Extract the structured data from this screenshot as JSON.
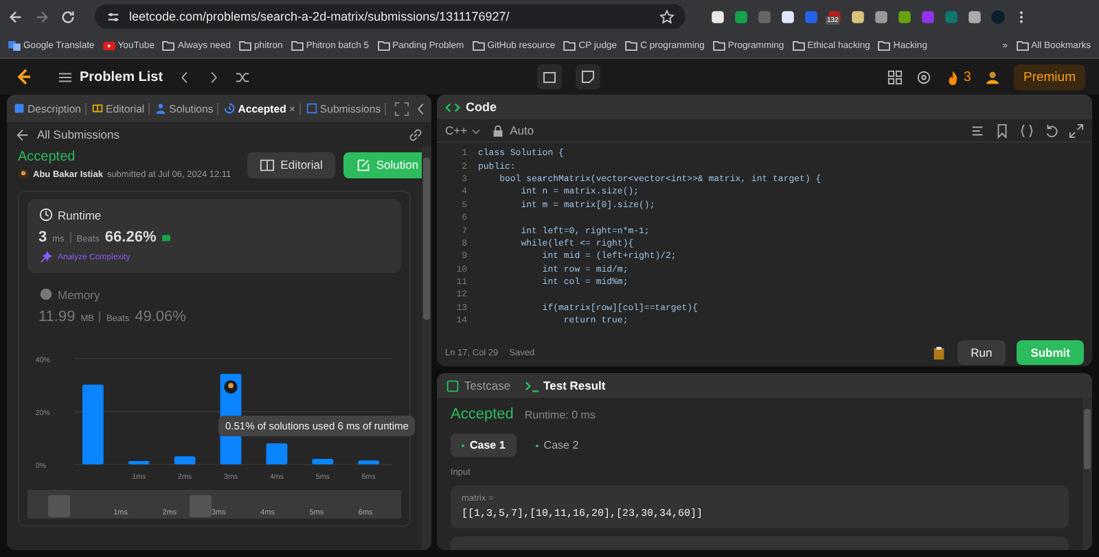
{
  "browser": {
    "url": "leetcode.com/problems/search-a-2d-matrix/submissions/1311176927/",
    "extension_badge": "132",
    "bookmarks": [
      {
        "label": "Google Translate",
        "kind": "translate"
      },
      {
        "label": "YouTube",
        "kind": "video"
      },
      {
        "label": "Always need",
        "kind": "folder"
      },
      {
        "label": "phitron",
        "kind": "folder"
      },
      {
        "label": "Phitron batch 5",
        "kind": "folder"
      },
      {
        "label": "Panding Problem",
        "kind": "folder"
      },
      {
        "label": "GitHub resource",
        "kind": "folder"
      },
      {
        "label": "CP judge",
        "kind": "folder"
      },
      {
        "label": "C programming",
        "kind": "folder"
      },
      {
        "label": "Programming",
        "kind": "folder"
      },
      {
        "label": "Ethical hacking",
        "kind": "folder"
      },
      {
        "label": "Hacking",
        "kind": "folder"
      }
    ],
    "more": "»",
    "all_bookmarks": "All Bookmarks"
  },
  "nav": {
    "problem_list": "Problem List",
    "streak": "3",
    "premium": "Premium"
  },
  "left": {
    "tabs": [
      {
        "label": "Description",
        "kind": "description",
        "selected": false
      },
      {
        "label": "Editorial",
        "kind": "editorial",
        "selected": false
      },
      {
        "label": "Solutions",
        "kind": "solutions",
        "selected": false
      },
      {
        "label": "Accepted",
        "kind": "accepted",
        "selected": true,
        "close": "×"
      },
      {
        "label": "Submissions",
        "kind": "submissions",
        "selected": false
      }
    ],
    "back": "All Submissions",
    "status": "Accepted",
    "author": "Abu Bakar Istiak",
    "submitted": "submitted at Jul 06, 2024 12:11",
    "editorial_button": "Editorial",
    "solution_button": "Solution",
    "metrics": [
      {
        "kind": "runtime",
        "title": "Runtime",
        "value": "3",
        "unit": "ms",
        "beats_label": "Beats",
        "beats": "66.26%",
        "selected": true,
        "extra": "Analyze Complexity"
      },
      {
        "kind": "memory",
        "title": "Memory",
        "value": "11.99",
        "unit": "MB",
        "beats_label": "Beats",
        "beats": "49.06%",
        "selected": false
      }
    ],
    "chart_data": {
      "type": "bar",
      "x": [
        0,
        1,
        2,
        3,
        4,
        5,
        6
      ],
      "xlim": [
        -0.5,
        6.5
      ],
      "values": [
        30.2,
        1.3,
        3.1,
        34.3,
        8,
        2.1,
        1.5
      ],
      "xticks": [
        {
          "value": 1,
          "label": "1ms"
        },
        {
          "value": 2,
          "label": "2ms"
        },
        {
          "value": 3,
          "label": "3ms"
        },
        {
          "value": 4,
          "label": "4ms"
        },
        {
          "value": 5,
          "label": "5ms"
        },
        {
          "value": 6,
          "label": "6ms"
        }
      ],
      "yticks": [
        {
          "value": 0,
          "label": "0%"
        },
        {
          "value": 20,
          "label": "20%"
        },
        {
          "value": 40,
          "label": "40%"
        }
      ],
      "ylim": [
        0,
        40
      ]
    },
    "tooltip": "0.51% of solutions used 6 ms of runtime",
    "range_labels": [
      "1ms",
      "2ms",
      "3ms",
      "4ms",
      "5ms",
      "6ms"
    ]
  },
  "code": {
    "title": "Code",
    "language": "C++",
    "mode": "Auto",
    "lines": [
      {
        "n": "1",
        "text": "class Solution {"
      },
      {
        "n": "2",
        "text": "public:"
      },
      {
        "n": "3",
        "text": "    bool searchMatrix(vector<vector<int>>& matrix, int target) {"
      },
      {
        "n": "4",
        "text": "        int n = matrix.size();"
      },
      {
        "n": "5",
        "text": "        int m = matrix[0].size();"
      },
      {
        "n": "6"
      },
      {
        "n": "7",
        "text": "        int left=0, right=n*m-1;"
      },
      {
        "n": "8",
        "text": "        while(left <= right){"
      },
      {
        "n": "9",
        "text": "            int mid = (left+right)/2;"
      },
      {
        "n": "10",
        "text": "            int row = mid/m;"
      },
      {
        "n": "11",
        "text": "            int col = mid%m;"
      },
      {
        "n": "12"
      },
      {
        "n": "13",
        "text": "            if(matrix[row][col]==target){"
      },
      {
        "n": "14",
        "text": "                return true;"
      }
    ],
    "cursor": "Ln 17, Col 29",
    "saved": "Saved",
    "run": "Run",
    "submit": "Submit"
  },
  "result": {
    "tabs": [
      {
        "label": "Testcase",
        "kind": "testcase",
        "selected": false
      },
      {
        "label": "Test Result",
        "kind": "result",
        "selected": true
      }
    ],
    "status": "Accepted",
    "runtime": "Runtime: 0 ms",
    "cases": [
      {
        "label": "Case 1",
        "selected": true
      },
      {
        "label": "Case 2",
        "selected": false
      }
    ],
    "input_label": "Input",
    "inputs": [
      {
        "name": "matrix =",
        "value": "[[1,3,5,7],[10,11,16,20],[23,30,34,60]]"
      }
    ]
  }
}
